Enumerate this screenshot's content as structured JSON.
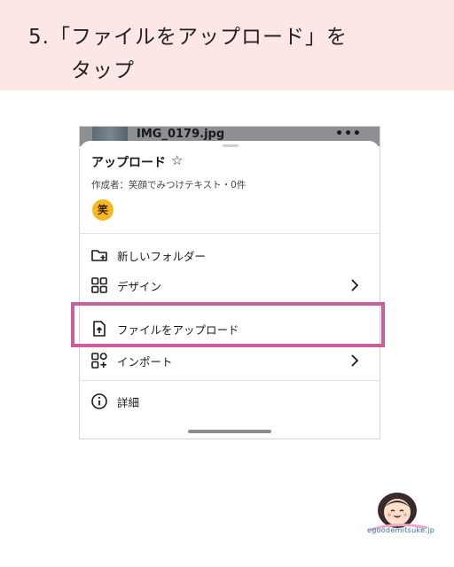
{
  "banner": {
    "line1": "5.「ファイルをアップロード」を",
    "line2": "タップ"
  },
  "top_bar": {
    "file_name": "IMG_0179.jpg",
    "more_label": "•••"
  },
  "sheet": {
    "title": "アップロード",
    "meta": "作成者：笑顔でみつけテキスト・0件",
    "avatar_char": "笑"
  },
  "menu": {
    "new_folder": "新しいフォルダー",
    "design": "デザイン",
    "upload_file": "ファイルをアップロード",
    "import": "インポート",
    "details": "詳細"
  },
  "icons": {
    "star": "star-outline-icon",
    "folder": "folder-plus-icon",
    "design": "grid-icon",
    "upload": "file-upload-icon",
    "import": "import-icon",
    "info": "info-icon",
    "chevron": "chevron-right-icon"
  },
  "colors": {
    "banner_bg": "#fde6e6",
    "highlight": "#cc5e9b",
    "avatar": "#f5b820",
    "logo_blue": "#2b6fb6"
  },
  "logo": {
    "text": "egoodemitsuke.jp"
  }
}
